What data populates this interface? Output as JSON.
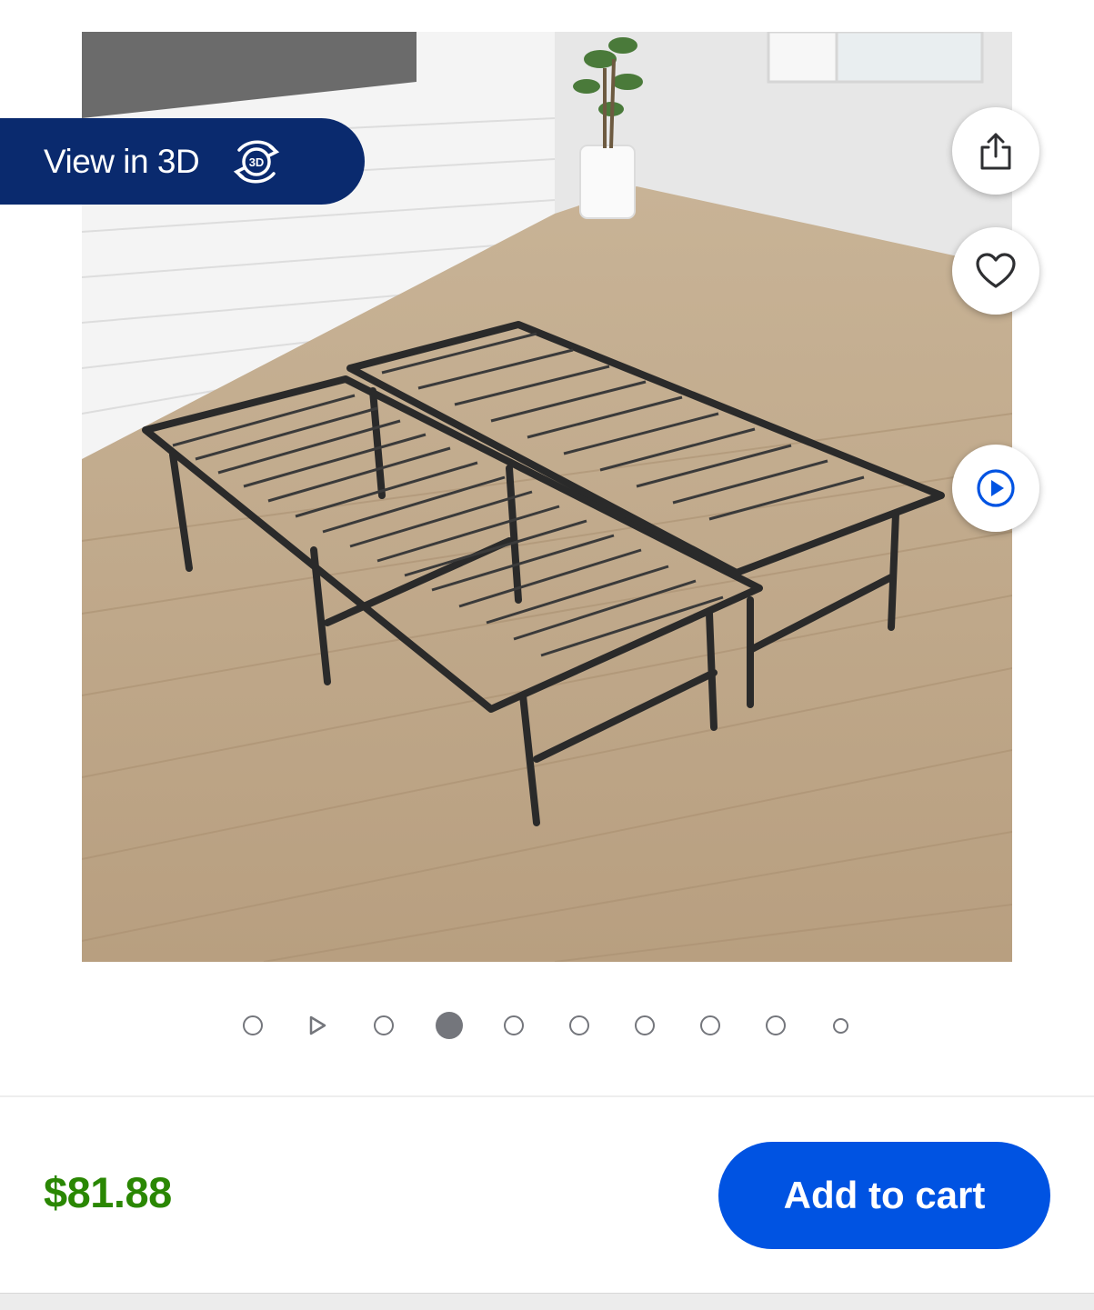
{
  "product_image": {
    "alt_subject": "bed-frame"
  },
  "view3d": {
    "label": "View in 3D",
    "icon": "3d-rotate-icon",
    "icon_text": "3D"
  },
  "actions": {
    "share_icon": "share-icon",
    "favorite_icon": "heart-icon",
    "video_icon": "play-circle-icon"
  },
  "carousel": {
    "total": 10,
    "active_index": 3,
    "video_index": 1
  },
  "footer": {
    "price": "$81.88",
    "add_to_cart_label": "Add to cart"
  },
  "colors": {
    "brand_blue": "#0053e2",
    "badge_navy": "#0a2a6e",
    "price_green": "#2a8703"
  }
}
